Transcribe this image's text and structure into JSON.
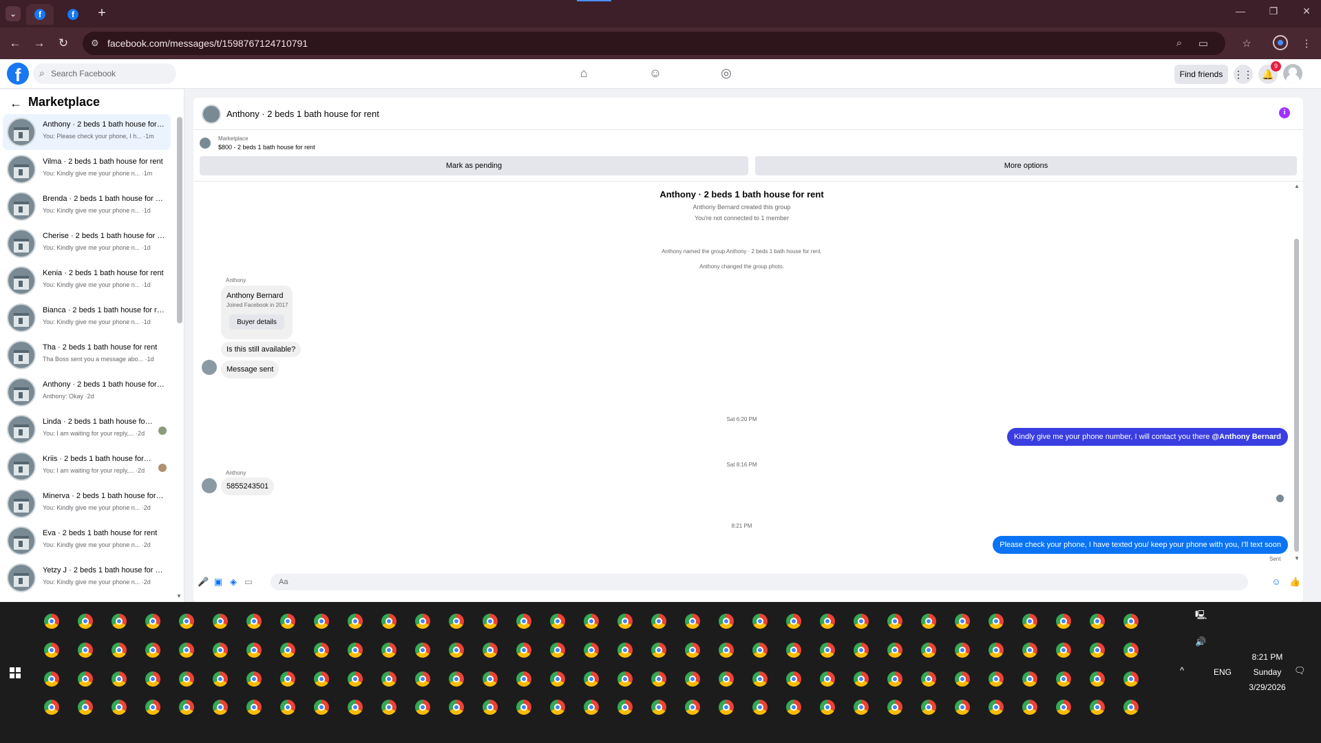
{
  "browser": {
    "url": "facebook.com/messages/t/1598767124710791",
    "new_tab": "+",
    "win_min": "—",
    "win_restore": "❐",
    "win_close": "✕"
  },
  "header": {
    "search_placeholder": "Search Facebook",
    "find_friends": "Find friends",
    "notif_count": "9"
  },
  "sidebar": {
    "title": "Marketplace",
    "conversations": [
      {
        "name": "Anthony · 2 beds 1 bath house for rent",
        "snippet": "You: Please check your phone, I h... ·1m"
      },
      {
        "name": "Vilma · 2 beds 1 bath house for rent",
        "snippet": "You: Kindly give me your phone n... ·1m"
      },
      {
        "name": "Brenda · 2 beds 1 bath house for rent",
        "snippet": "You: Kindly give me your phone n... ·1d"
      },
      {
        "name": "Cherise · 2 beds 1 bath house for rent",
        "snippet": "You: Kindly give me your phone n... ·1d"
      },
      {
        "name": "Kenia · 2 beds 1 bath house for rent",
        "snippet": "You: Kindly give me your phone n... ·1d"
      },
      {
        "name": "Bianca · 2 beds 1 bath house for rent",
        "snippet": "You: Kindly give me your phone n... ·1d"
      },
      {
        "name": "Tha · 2 beds 1 bath house for rent",
        "snippet": "Tha Boss sent you a message abo... ·1d"
      },
      {
        "name": "Anthony · 2 beds 1 bath house for rent",
        "snippet": "Anthony: Okay ·2d"
      },
      {
        "name": "Linda · 2 beds 1 bath house for rent",
        "snippet": "You: I am waiting for your reply,... ·2d"
      },
      {
        "name": "Kriis · 2 beds 1 bath house for rent",
        "snippet": "You: I am waiting for your reply,... ·2d"
      },
      {
        "name": "Minerva · 2 beds 1 bath house for rent",
        "snippet": "You: Kindly give me your phone n... ·2d"
      },
      {
        "name": "Eva · 2 beds 1 bath house for rent",
        "snippet": "You: Kindly give me your phone n... ·2d"
      },
      {
        "name": "Yetzy J · 2 beds 1 bath house for rent",
        "snippet": "You: Kindly give me your phone n... ·2d"
      }
    ]
  },
  "chat": {
    "title": "Anthony · 2 beds 1 bath house for rent",
    "listing_label": "Marketplace",
    "listing_price": "$800 - 2 beds 1 bath house for rent",
    "mark_pending": "Mark as pending",
    "more_options": "More options",
    "thread_title": "Anthony · 2 beds 1 bath house for rent",
    "created": "Anthony Bernard created this group",
    "not_connected": "You're not connected to 1 member",
    "named": "Anthony named the group Anthony · 2 beds 1 bath house for rent.",
    "changed_photo": "Anthony changed the group photo.",
    "sender": "Anthony",
    "card_name": "Anthony Bernard",
    "card_joined": "Joined Facebook in 2017",
    "buyer_details": "Buyer details",
    "msg_available": "Is this still available?",
    "msg_sent": "Message sent",
    "time1": "Sat 6:20 PM",
    "out1_text": "Kindly give me your phone number, I will contact you there ",
    "out1_mention": "@Anthony Bernard",
    "time2": "Sat 8:16 PM",
    "sender2": "Anthony",
    "msg_phone": "5855243501",
    "time3": "8:21 PM",
    "out2_text": "Please check your phone, I have texted you/ keep your phone with you, I'll text soon",
    "sent_label": "Sent",
    "composer_placeholder": "Aa"
  },
  "tray": {
    "lang": "ENG",
    "time": "8:21 PM",
    "day": "Sunday",
    "date": "3/29/2026"
  }
}
